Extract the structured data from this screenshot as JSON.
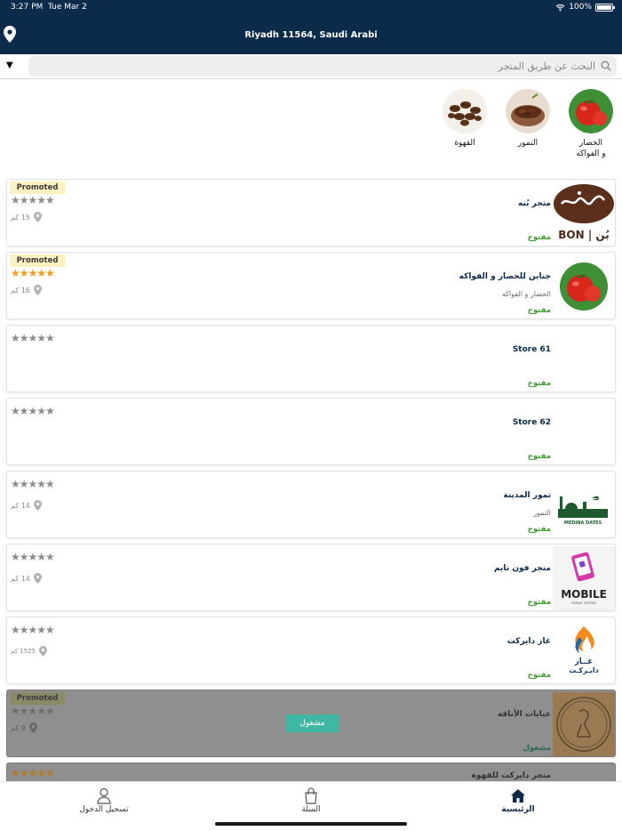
{
  "status": {
    "time": "3:27 PM",
    "date": "Tue Mar 2",
    "battery": "100%"
  },
  "header": {
    "location": "Riyadh 11564, Saudi Arabi",
    "icons": [
      "map-pin-icon",
      "wifi-icon",
      "battery-icon"
    ]
  },
  "search": {
    "placeholder": "البحث عن طريق المتجر",
    "dropdown_glyph": "▼"
  },
  "categories": [
    {
      "label_line1": "الخضار",
      "label_line2": "و الفواكه",
      "image": "tomato"
    },
    {
      "label_line1": "التمور",
      "label_line2": "",
      "image": "dates"
    },
    {
      "label_line1": "القهوة",
      "label_line2": "",
      "image": "coffee-beans"
    }
  ],
  "stores": [
    {
      "name": "متجر بُنه",
      "subtitle": "",
      "status": "مفتوح",
      "promoted": "Promoted",
      "distance": "15 كم",
      "stars": "★★★★★",
      "rating": 0,
      "logo": "bon-logo",
      "logo_text": "BON | بُن"
    },
    {
      "name": "جناين للخضار و الفواكه",
      "subtitle": "الخضار و الفواكه",
      "status": "مفتوح",
      "promoted": "Promoted",
      "distance": "16 كم",
      "stars": "★★★★★",
      "rating": 5,
      "logo": "tomato"
    },
    {
      "name": "Store 61",
      "subtitle": "",
      "status": "مفتوح",
      "promoted": "",
      "distance": "",
      "stars": "★★★★★",
      "rating": 0,
      "logo": ""
    },
    {
      "name": "Store 62",
      "subtitle": "",
      "status": "مفتوح",
      "promoted": "",
      "distance": "",
      "stars": "★★★★★",
      "rating": 0,
      "logo": ""
    },
    {
      "name": "تمور المدينة",
      "subtitle": "التمور",
      "status": "مفتوح",
      "promoted": "",
      "distance": "14 كم",
      "stars": "★★★★★",
      "rating": 0,
      "logo": "madina-dates-logo",
      "logo_text": "MEDINA DATES"
    },
    {
      "name": "متجر فون تايم",
      "subtitle": "",
      "status": "مفتوح",
      "promoted": "",
      "distance": "14 كم",
      "stars": "★★★★★",
      "rating": 0,
      "logo": "mobile-repair-logo",
      "logo_text": "MOBILE",
      "logo_subtext": "REPAIR CENTER"
    },
    {
      "name": "غاز دايركت",
      "subtitle": "",
      "status": "مفتوح",
      "promoted": "",
      "distance": "1525 كم",
      "stars": "★★★★★",
      "rating": 0,
      "logo": "gas-direct-logo",
      "logo_text": "غــاز",
      "logo_subtext": "دايـركـت"
    },
    {
      "name": "عبايات الأناقة",
      "subtitle": "",
      "status": "مشغول",
      "promoted": "Promoted",
      "distance": "9 كم",
      "stars": "★★★★★",
      "rating": 0,
      "logo": "abaya-logo",
      "busy_label": "مشغول"
    },
    {
      "name": "متجر دايركت للقهوة",
      "stars": "★★★★★",
      "rating": 5,
      "logo": "coffee-direct-logo"
    }
  ],
  "tabs": [
    {
      "label": "الرئيسية",
      "icon": "home-icon",
      "active": true
    },
    {
      "label": "السلة",
      "icon": "bag-icon",
      "active": false
    },
    {
      "label": "تسجيل الدخول",
      "icon": "user-icon",
      "active": false
    }
  ],
  "colors": {
    "navy": "#0c2a4a",
    "open_green": "#3a9a2a",
    "promo_bg": "#fdf2bf",
    "star_gold": "#f39c1f",
    "busy_teal": "#3fb7a3"
  }
}
